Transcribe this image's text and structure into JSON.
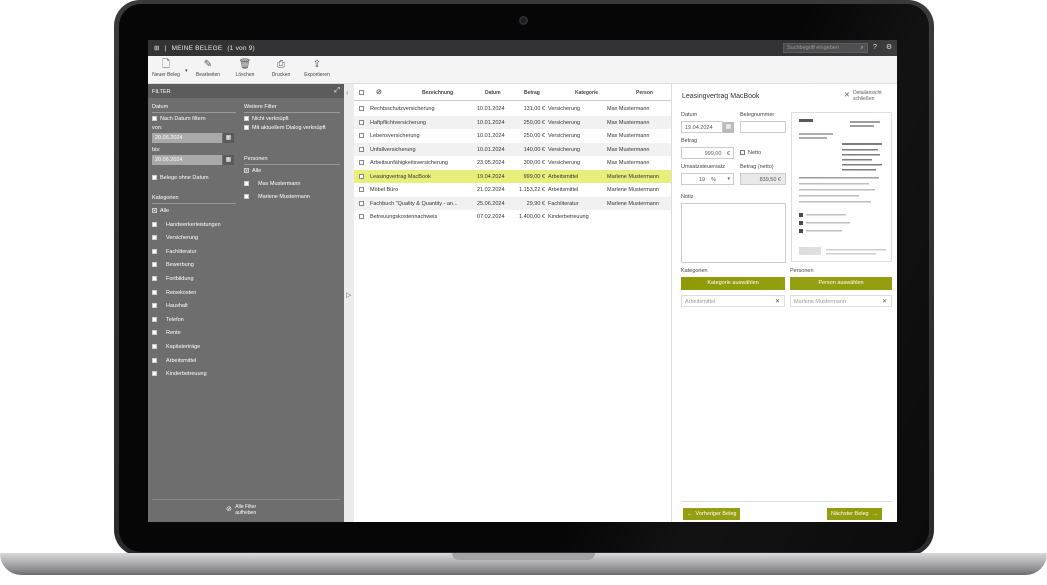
{
  "app": {
    "title": "MEINE BELEGE",
    "page_indicator": "(1 von 9)",
    "search_placeholder": "Suchbegriff eingeben"
  },
  "toolbar": {
    "new_label": "Neuer Beleg",
    "edit_label": "Bearbeiten",
    "delete_label": "Löschen",
    "print_label": "Drucken",
    "export_label": "Exportieren"
  },
  "sidebar": {
    "header": "FILTER",
    "date_label": "Datum",
    "filter_by_date": "Nach Datum filtern",
    "from_label": "von:",
    "from_value": "20.06.2024",
    "to_label": "bis:",
    "to_value": "20.06.2024",
    "without_date": "Belege ohne Datum",
    "more_filters_label": "Weitere Filter",
    "unlinked": "Nicht verknüpft",
    "linked_current": "Mit aktuellem Dialog verknüpft",
    "persons_label": "Personen",
    "persons": [
      "Alle",
      "Max Mustermann",
      "Marlene Mustermann"
    ],
    "categories_label": "Kategorien",
    "categories": [
      "Alle",
      "Handwerkerleistungen",
      "Versicherung",
      "Fachliteratur",
      "Bewerbung",
      "Fortbildung",
      "Reisekosten",
      "Haushalt",
      "Telefon",
      "Rente",
      "Kapitalerträge",
      "Arbeitsmittel",
      "Kinderbetreuung"
    ],
    "clear_filters": "Alle Filter aufheben"
  },
  "table": {
    "columns": [
      "Bezeichnung",
      "Datum",
      "Betrag",
      "Kategorie",
      "Person"
    ],
    "rows": [
      {
        "name": "Rechtsschutzversicherung",
        "date": "10.01.2024",
        "amount": "131,00 €",
        "category": "Versicherung",
        "person": "Max Mustermann"
      },
      {
        "name": "Haftpflichtversicherung",
        "date": "10.01.2024",
        "amount": "250,00 €",
        "category": "Versicherung",
        "person": "Max Mustermann"
      },
      {
        "name": "Lebensversicherung",
        "date": "10.01.2024",
        "amount": "250,00 €",
        "category": "Versicherung",
        "person": "Max Mustermann"
      },
      {
        "name": "Unfallversicherung",
        "date": "10.01.2024",
        "amount": "140,00 €",
        "category": "Versicherung",
        "person": "Max Mustermann"
      },
      {
        "name": "Arbeitsunfähigkeitsversicherung",
        "date": "23.05.2024",
        "amount": "300,00 €",
        "category": "Versicherung",
        "person": "Max Mustermann"
      },
      {
        "name": "Leasingvertrag MacBook",
        "date": "19.04.2024",
        "amount": "999,00 €",
        "category": "Arbeitsmittel",
        "person": "Marlene Mustermann"
      },
      {
        "name": "Möbel Büro",
        "date": "21.02.2024",
        "amount": "1.153,22 €",
        "category": "Arbeitsmittel",
        "person": "Marlene Mustermann"
      },
      {
        "name": "Fachbuch \"Quality & Quantity - an...",
        "date": "25.06.2024",
        "amount": "29,90 €",
        "category": "Fachliteratur",
        "person": "Marlene Mustermann"
      },
      {
        "name": "Betreuungskostennachweis",
        "date": "07.02.2024",
        "amount": "1.400,00 €",
        "category": "Kinderbetreuung",
        "person": ""
      }
    ]
  },
  "detail": {
    "title": "Leasingvertrag MacBook",
    "close_label": "Detailansicht schließen",
    "date_label": "Datum",
    "date_value": "19.04.2024",
    "number_label": "Belegnummer",
    "number_value": "",
    "amount_label": "Betrag",
    "amount_value": "999,00",
    "currency": "€",
    "net_label": "Netto",
    "vat_label": "Umsatzsteuersatz",
    "vat_value": "19",
    "percent": "%",
    "net_amount_label": "Betrag (netto)",
    "net_amount_value": "839,50 €",
    "note_label": "Notiz",
    "categories_label": "Kategorien",
    "select_category": "Kategorie auswählen",
    "category_tag": "Arbeitsmittel",
    "persons_label": "Personen",
    "select_person": "Person auswählen",
    "person_tag": "Marlene Mustermann",
    "prev_label": "Vorheriger Beleg",
    "next_label": "Nächster Beleg"
  },
  "colors": {
    "accent": "#8f9a05",
    "selected_row": "#e8ee7a",
    "sidebar": "#6e6e6e",
    "topbar": "#333335"
  }
}
